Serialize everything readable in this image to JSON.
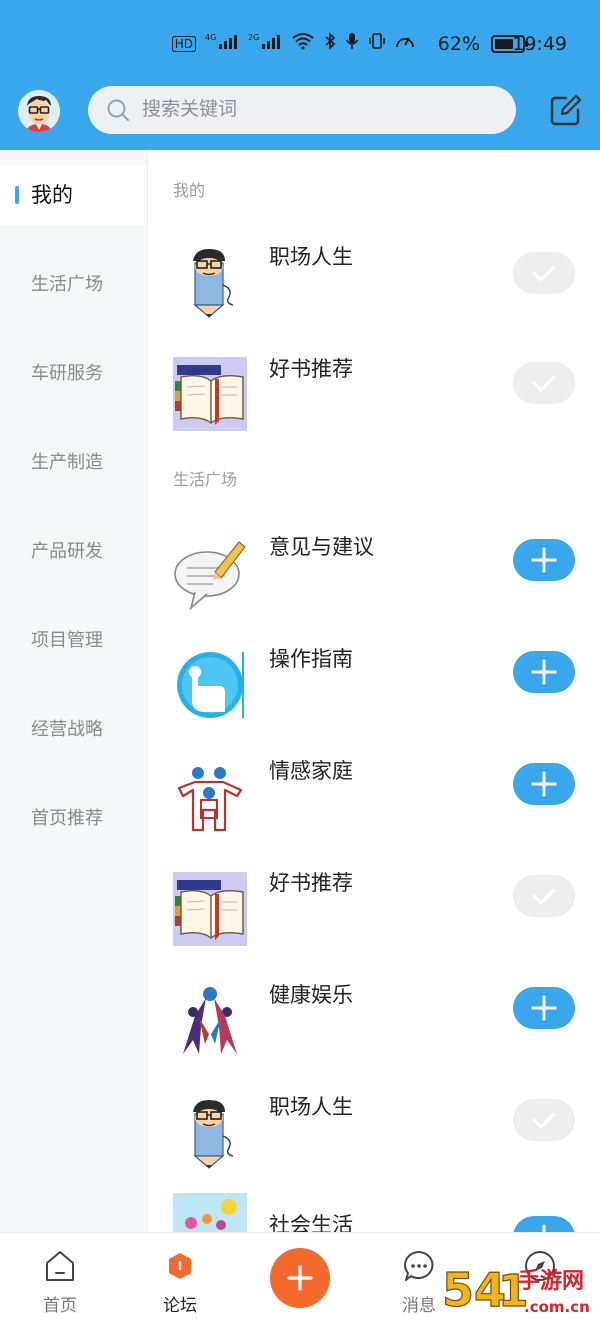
{
  "status_bar": {
    "network_icons": [
      "HD",
      "4G",
      "2G"
    ],
    "battery_percent": "62%",
    "time": "19:49"
  },
  "header": {
    "search_placeholder": "搜索关键词"
  },
  "sidebar": {
    "items": [
      {
        "label": "我的",
        "active": true
      },
      {
        "label": "生活广场",
        "active": false
      },
      {
        "label": "车研服务",
        "active": false
      },
      {
        "label": "生产制造",
        "active": false
      },
      {
        "label": "产品研发",
        "active": false
      },
      {
        "label": "项目管理",
        "active": false
      },
      {
        "label": "经营战略",
        "active": false
      },
      {
        "label": "首页推荐",
        "active": false
      }
    ]
  },
  "sections": [
    {
      "title": "我的",
      "forums": [
        {
          "name": "职场人生",
          "state": "joined",
          "icon": "pencil-man-icon"
        },
        {
          "name": "好书推荐",
          "state": "joined",
          "icon": "open-book-icon"
        }
      ]
    },
    {
      "title": "生活广场",
      "forums": [
        {
          "name": "意见与建议",
          "state": "add",
          "icon": "speech-pen-icon"
        },
        {
          "name": "操作指南",
          "state": "add",
          "icon": "touch-hand-icon"
        },
        {
          "name": "情感家庭",
          "state": "add",
          "icon": "family-icon"
        },
        {
          "name": "好书推荐",
          "state": "joined",
          "icon": "open-book-icon"
        },
        {
          "name": "健康娱乐",
          "state": "add",
          "icon": "dancers-icon"
        },
        {
          "name": "职场人生",
          "state": "joined",
          "icon": "pencil-man-icon"
        },
        {
          "name": "社会生活",
          "state": "add",
          "icon": "scenery-icon"
        }
      ]
    }
  ],
  "bottom_nav": {
    "items": [
      {
        "label": "首页",
        "icon": "home-icon",
        "active": false
      },
      {
        "label": "论坛",
        "icon": "forum-icon",
        "active": true
      },
      {
        "label": "消息",
        "icon": "message-icon",
        "active": false
      },
      {
        "label": "",
        "icon": "discover-icon",
        "active": false
      }
    ],
    "fab_icon": "plus-icon"
  },
  "watermark": "54一手游网 .com.cn",
  "colors": {
    "accent": "#3aa6ec",
    "fab": "#f26a2e",
    "joined_toggle": "#eeeeee"
  }
}
